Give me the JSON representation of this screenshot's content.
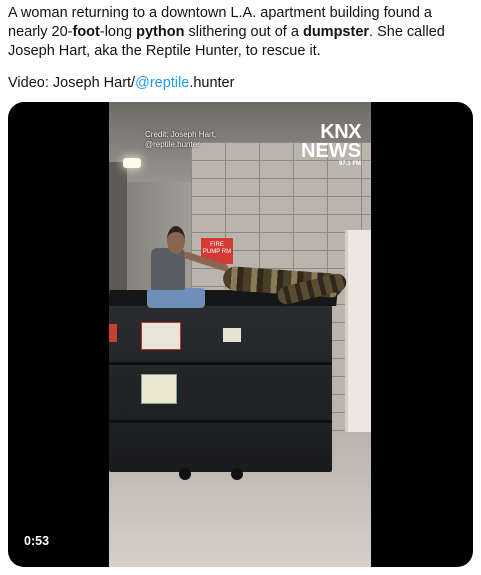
{
  "tweet": {
    "text_parts": {
      "p1": "A woman returning to a downtown L.A. apartment building found a nearly 20-",
      "b1": "foot",
      "p2": "-long ",
      "b2": "python",
      "p3": " slithering out of a ",
      "b3": "dumpster",
      "p4": ".  She called Joseph Hart, aka the Reptile Hunter, to rescue it."
    },
    "credit_prefix": "Video: Joseph Hart/",
    "credit_mention": "@reptile",
    "credit_suffix": ".hunter"
  },
  "video": {
    "duration": "0:53",
    "overlay_credit": "Credit: Joseph Hart, @reptile.hunter",
    "station_logo": {
      "line1": "KNX",
      "line2": "NEWS",
      "line3": "97.1 FM"
    },
    "sign_text": "FIRE PUMP RM"
  },
  "colors": {
    "mention": "#1d9bf0",
    "background": "#ffffff",
    "video_bg": "#000000"
  }
}
